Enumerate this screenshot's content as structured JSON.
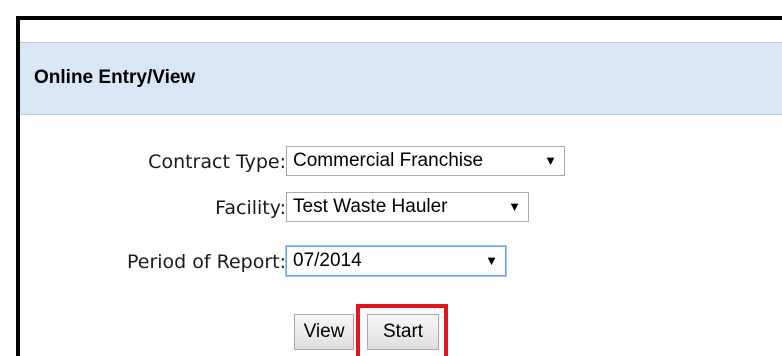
{
  "panel": {
    "title": "Online Entry/View"
  },
  "form": {
    "contract_type": {
      "label": "Contract Type:",
      "value": "Commercial Franchise"
    },
    "facility": {
      "label": "Facility:",
      "value": "Test Waste Hauler"
    },
    "period": {
      "label": "Period of Report:",
      "value": "07/2014"
    }
  },
  "buttons": {
    "view_label": "View",
    "start_label": "Start"
  },
  "icons": {
    "dropdown_arrow": "▼"
  },
  "colors": {
    "header_bg": "#d9e6f5",
    "highlight": "#e8141b"
  }
}
